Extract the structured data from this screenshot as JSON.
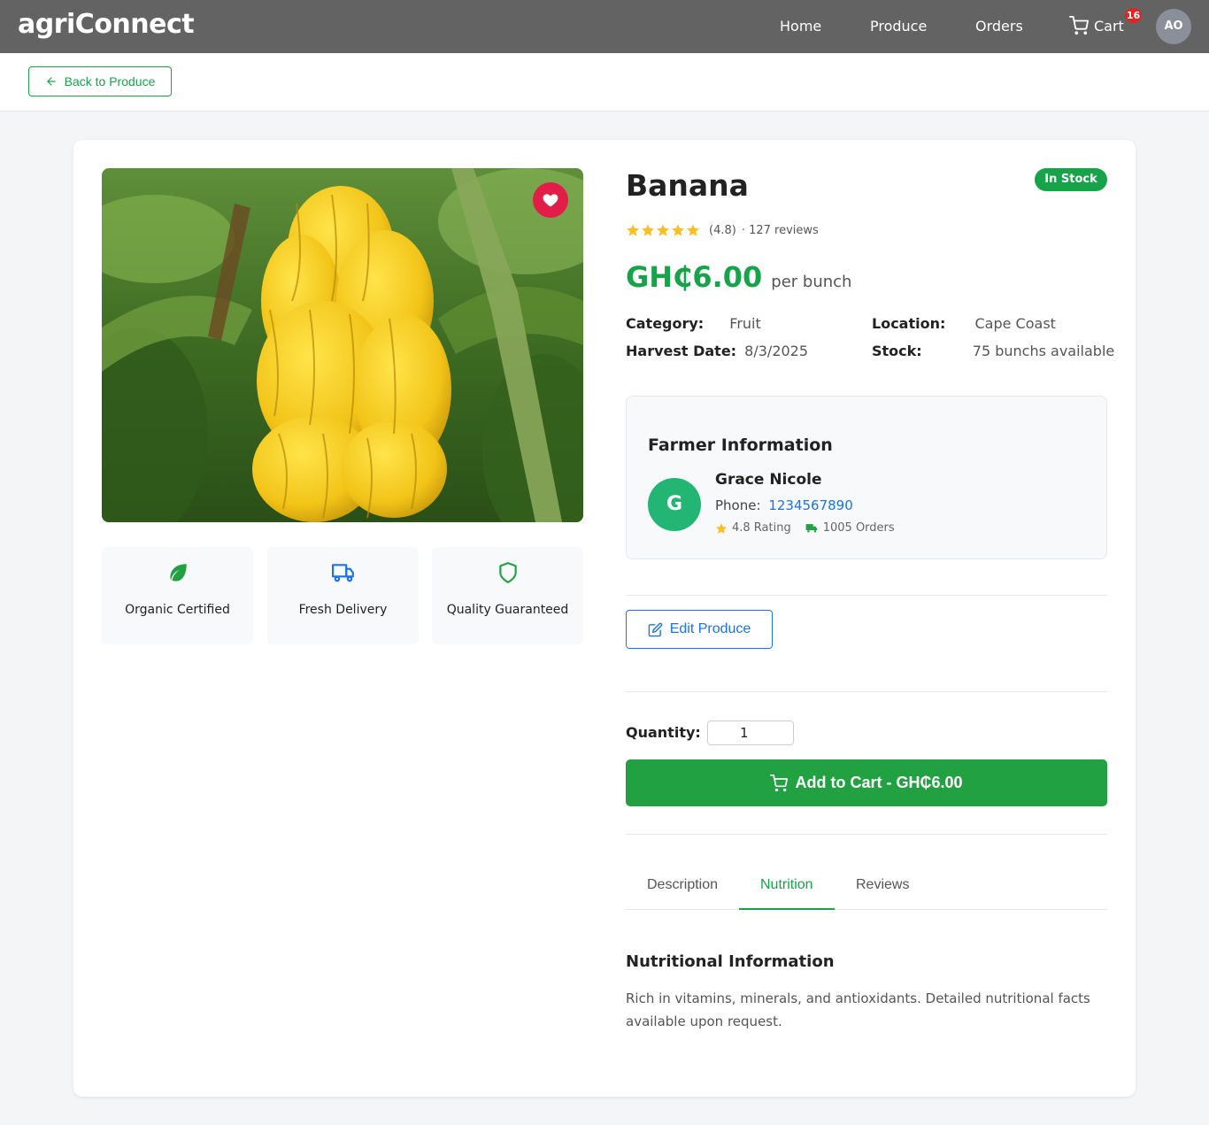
{
  "app": {
    "brand": "agriConnect"
  },
  "nav": {
    "home": "Home",
    "produce": "Produce",
    "orders": "Orders",
    "cart_label": "Cart",
    "cart_count": "16",
    "avatar_initials": "AO"
  },
  "subnav": {
    "back_label": "Back to Produce"
  },
  "product": {
    "name": "Banana",
    "stock_status": "In Stock",
    "rating": "(4.8)",
    "reviews": "· 127 reviews",
    "price": "GH₵6.00",
    "price_unit": "per bunch",
    "category_label": "Category:",
    "category": "Fruit",
    "location_label": "Location:",
    "location": "Cape Coast",
    "harvest_label": "Harvest Date:",
    "harvest_date": "8/3/2025",
    "stock_label": "Stock:",
    "stock": "75 bunchs available"
  },
  "features": [
    {
      "label": "Organic Certified",
      "icon": "leaf-icon"
    },
    {
      "label": "Fresh Delivery",
      "icon": "truck-icon"
    },
    {
      "label": "Quality Guaranteed",
      "icon": "shield-icon"
    }
  ],
  "farmer": {
    "heading": "Farmer Information",
    "initial": "G",
    "name": "Grace Nicole",
    "phone_label": "Phone:",
    "phone": "1234567890",
    "rating": "4.8 Rating",
    "orders": "1005 Orders"
  },
  "actions": {
    "edit_label": "Edit Produce",
    "quantity_label": "Quantity:",
    "quantity_value": "1",
    "add_to_cart": "Add to Cart - GH₵6.00"
  },
  "tabs": [
    {
      "label": "Description",
      "active": false
    },
    {
      "label": "Nutrition",
      "active": true
    },
    {
      "label": "Reviews",
      "active": false
    }
  ],
  "nutrition": {
    "heading": "Nutritional Information",
    "text": "Rich in vitamins, minerals, and antioxidants. Detailed nutritional facts available upon request."
  },
  "colors": {
    "brand_green": "#16a34a",
    "navbar": "#636363",
    "link_blue": "#1a73e8",
    "favorite_red": "#e11d48",
    "star_yellow": "#fbbf24"
  }
}
